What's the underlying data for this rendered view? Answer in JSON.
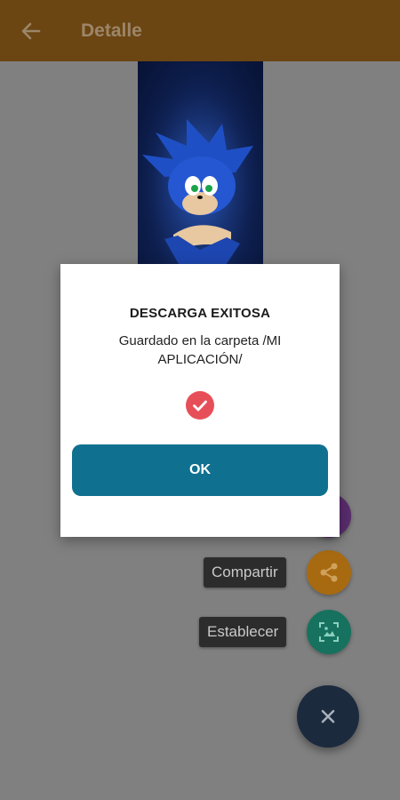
{
  "appbar": {
    "title": "Detalle",
    "back_icon": "arrow-left-icon",
    "color": "#6b4512"
  },
  "wallpaper": {
    "description_icon": "wallpaper-image"
  },
  "dialog": {
    "title": "DESCARGA EXITOSA",
    "message": "Guardado en la carpeta /MI APLICACIÓN/",
    "status_icon": "check-circle-icon",
    "ok_label": "OK",
    "ok_color": "#10708f",
    "check_color": "#e74f58"
  },
  "speed_dial": {
    "items": [
      {
        "label": "",
        "icon": "download-icon",
        "color": "#5a2c6e"
      },
      {
        "label": "Compartir",
        "icon": "share-icon",
        "color": "#a86a10"
      },
      {
        "label": "Establecer",
        "icon": "set-wallpaper-icon",
        "color": "#16725e"
      }
    ],
    "close_icon": "close-icon",
    "main_color": "#1c2a3e"
  }
}
